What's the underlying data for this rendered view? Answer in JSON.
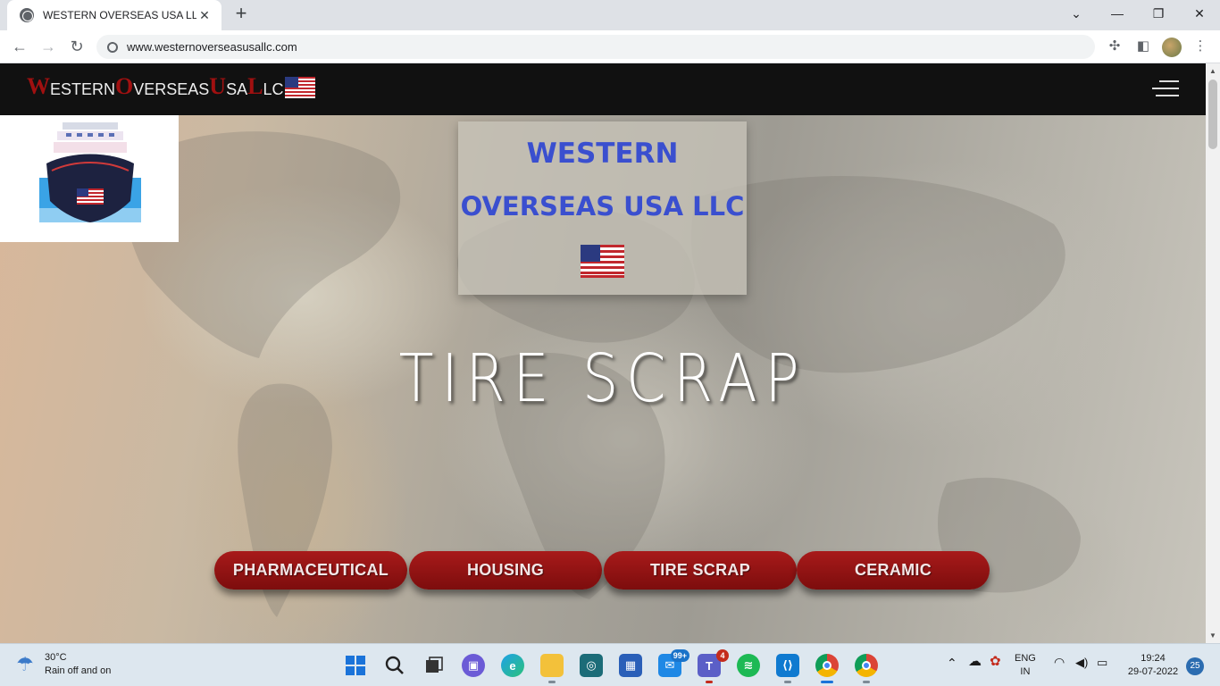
{
  "browser": {
    "tab_title": "WESTERN OVERSEAS USA LLC",
    "tab_close": "✕",
    "new_tab": "+",
    "url": "www.westernoverseasusallc.com",
    "window_controls": {
      "minimize": "—",
      "restore": "❐",
      "close": "✕",
      "tab_search": "⌄"
    }
  },
  "site": {
    "brand": [
      {
        "big": "W",
        "small": "ESTERN"
      },
      {
        "big": "O",
        "small": "VERSEAS"
      },
      {
        "big": "U",
        "small": "SA"
      },
      {
        "big": "L",
        "small": "LC"
      }
    ],
    "info_box": {
      "line1": "WESTERN",
      "line2": "OVERSEAS USA LLC"
    },
    "hero_title": "TIRE SCRAP",
    "categories": [
      "PHARMACEUTICAL",
      "HOUSING",
      "TIRE SCRAP",
      "CERAMIC"
    ]
  },
  "taskbar": {
    "weather": {
      "temp": "30°C",
      "desc": "Rain off and on"
    },
    "badges": {
      "mail": "99+",
      "teams": "4"
    },
    "language": {
      "line1": "ENG",
      "line2": "IN"
    },
    "clock": {
      "time": "19:24",
      "date": "29-07-2022"
    },
    "notifications": "25"
  },
  "colors": {
    "brand_red": "#a01010",
    "pill_red": "#8e1414",
    "info_blue": "#3a4fcf",
    "nav_bg": "#111111"
  }
}
